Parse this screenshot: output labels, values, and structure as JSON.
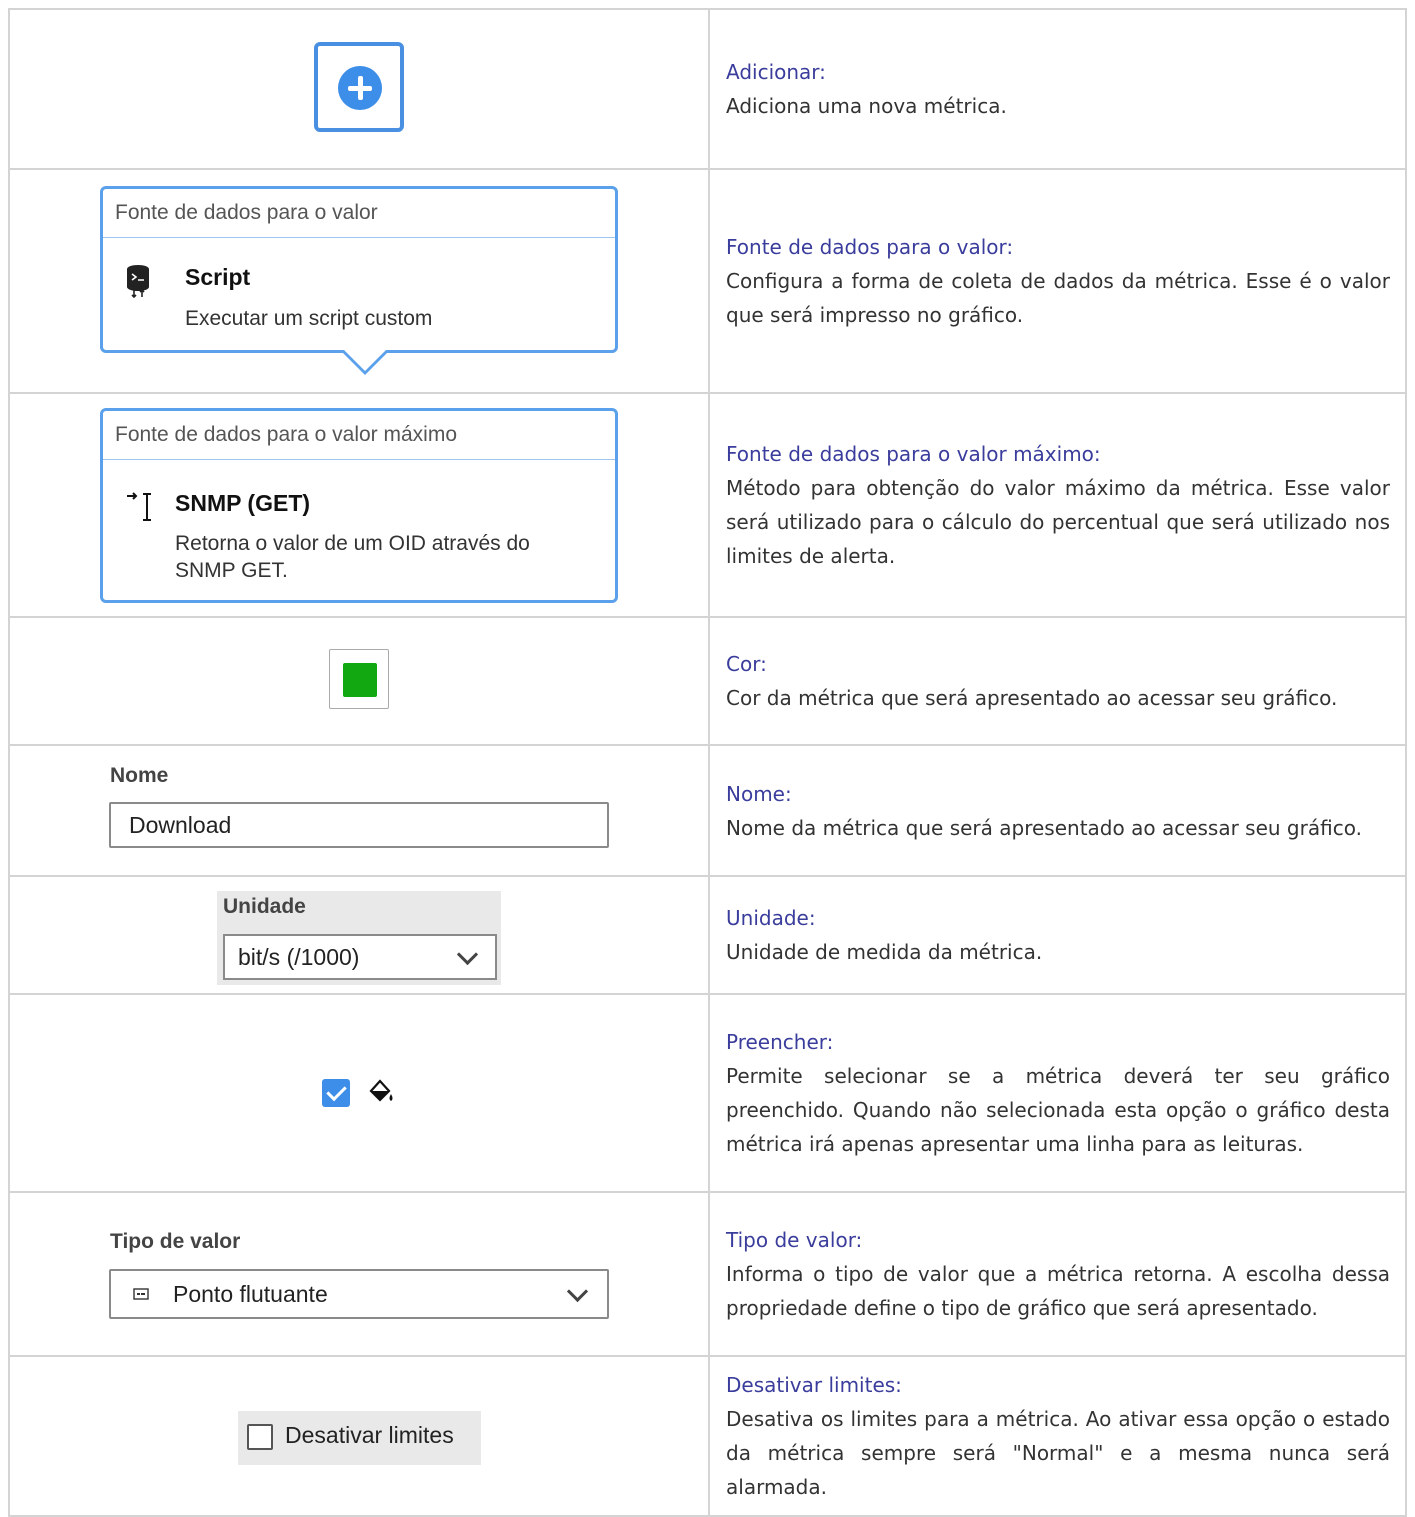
{
  "rows": [
    {
      "title": "Adicionar:",
      "description": "Adiciona uma nova métrica."
    },
    {
      "title": "Fonte de dados para o valor:",
      "description": "Configura a forma de coleta de dados da métrica. Esse é o valor que será impresso no gráfico."
    },
    {
      "title": "Fonte de dados para o valor máximo:",
      "description": "Método para obtenção do valor máximo da métrica. Esse valor será utilizado para o cálculo do percentual que será utilizado nos limites de alerta."
    },
    {
      "title": "Cor:",
      "description": "Cor da métrica que será apresentado ao acessar seu gráfico."
    },
    {
      "title": "Nome:",
      "description": "Nome da métrica que será apresentado ao acessar seu gráfico."
    },
    {
      "title": "Unidade:",
      "description": "Unidade de medida da métrica."
    },
    {
      "title": "Preencher:",
      "description": "Permite selecionar se a métrica deverá ter seu gráfico preenchido. Quando não selecionada esta opção o gráfico desta métrica irá apenas apresentar uma linha para as leituras."
    },
    {
      "title": "Tipo de valor:",
      "description": "Informa o tipo de valor que a métrica retorna. A escolha dessa propriedade define o tipo de gráfico que será apresentado."
    },
    {
      "title": "Desativar limites:",
      "description": "Desativa os limites para a métrica. Ao ativar essa opção o estado da métrica sempre será \"Normal\" e a mesma nunca será alarmada."
    }
  ],
  "widgets": {
    "value_source": {
      "header": "Fonte de dados para o valor",
      "name": "Script",
      "desc": "Executar um script custom",
      "icon": "script-icon"
    },
    "max_source": {
      "header": "Fonte de dados para o valor máximo",
      "name": "SNMP (GET)",
      "desc": "Retorna o valor de um OID através do SNMP GET.",
      "icon": "snmp-get-icon"
    },
    "color": {
      "value": "#11a811"
    },
    "name_field": {
      "label": "Nome",
      "value": "Download"
    },
    "unit": {
      "label": "Unidade",
      "value": "bit/s (/1000)"
    },
    "fill": {
      "checked": true,
      "icon": "paint-bucket-icon"
    },
    "value_type": {
      "label": "Tipo de valor",
      "value": "Ponto flutuante",
      "icon": "float-icon"
    },
    "disable_limits": {
      "label": "Desativar limites",
      "checked": false
    }
  }
}
